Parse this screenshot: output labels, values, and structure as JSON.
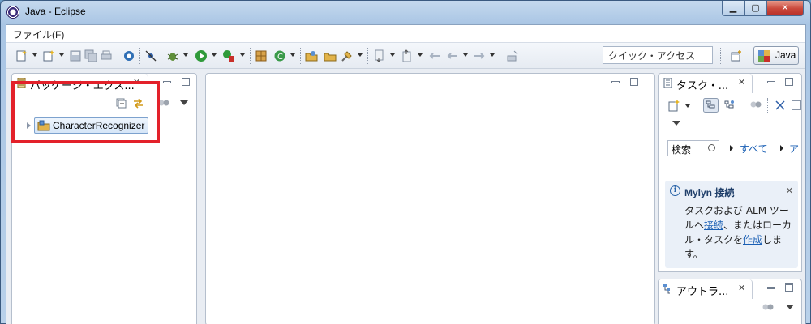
{
  "window": {
    "title": "Java - Eclipse"
  },
  "menu": {
    "file": "ファイル(F)"
  },
  "toolbar": {
    "quick_access_placeholder": "クイック・アクセス",
    "perspective_java": "Java"
  },
  "package_explorer": {
    "tab_label": "パッケージ・エクス...",
    "tree": [
      {
        "label": "CharacterRecognizer",
        "type": "project",
        "expanded": false
      }
    ]
  },
  "task_list": {
    "tab_label": "タスク・...",
    "search_label": "検索",
    "filter_all": "すべて",
    "filter_active": "ア",
    "mylyn": {
      "title": "Mylyn 接続",
      "line1": "タスクおよび ALM ツー",
      "line2_pre": "ルへ",
      "link_connect": "接続",
      "line2_post": "、またはローカ",
      "line3_pre": "ル・タスクを",
      "link_create": "作成",
      "line3_post": "しま",
      "line4": "す。"
    }
  },
  "outline": {
    "tab_label": "アウトラ..."
  },
  "colors": {
    "highlight": "#e3212a",
    "link": "#1a5fb4"
  }
}
